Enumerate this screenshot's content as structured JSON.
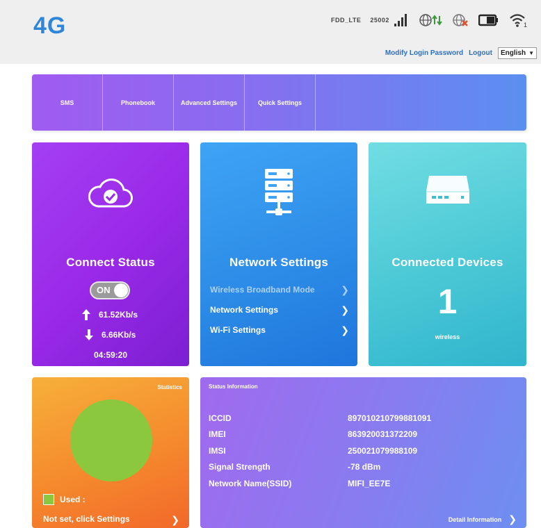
{
  "header": {
    "logo": "4G",
    "network_mode": "FDD_LTE",
    "network_code": "25002",
    "icons": [
      "signal-bars-icon",
      "globe-data-icon",
      "roaming-globe-off-icon",
      "battery-icon",
      "wifi-icon"
    ],
    "wifi_clients": "1",
    "links": {
      "modify_password": "Modify Login Password",
      "logout": "Logout"
    },
    "language": "English"
  },
  "nav": {
    "items": [
      {
        "label": "SMS"
      },
      {
        "label": "Phonebook"
      },
      {
        "label": "Advanced Settings"
      },
      {
        "label": "Quick Settings"
      }
    ]
  },
  "connect": {
    "title": "Connect Status",
    "icon": "cloud-check-icon",
    "toggle_label": "ON",
    "upload": "61.52Kb/s",
    "download": "6.66Kb/s",
    "uptime": "04:59:20"
  },
  "network": {
    "title": "Network Settings",
    "icon": "server-stack-icon",
    "links": [
      {
        "label": "Wireless Broadband Mode"
      },
      {
        "label": "Network Settings"
      },
      {
        "label": "Wi-Fi Settings"
      }
    ]
  },
  "devices": {
    "title": "Connected Devices",
    "icon": "router-device-icon",
    "count": "1",
    "subtitle": "wireless"
  },
  "stats": {
    "title": "Statistics",
    "legend_label": "Used  :",
    "settings_link": "Not set, click Settings",
    "colors": {
      "used": "#8cc83e"
    }
  },
  "info": {
    "title": "Status Information",
    "rows": [
      {
        "key": "ICCID",
        "value": "897010210799881091"
      },
      {
        "key": "IMEI",
        "value": "863920031372209"
      },
      {
        "key": "IMSI",
        "value": "250021079988109"
      },
      {
        "key": "Signal Strength",
        "value": "-78 dBm"
      },
      {
        "key": "Network Name(SSID)",
        "value": "MIFI_EE7E"
      }
    ],
    "detail_link": "Detail Information"
  }
}
